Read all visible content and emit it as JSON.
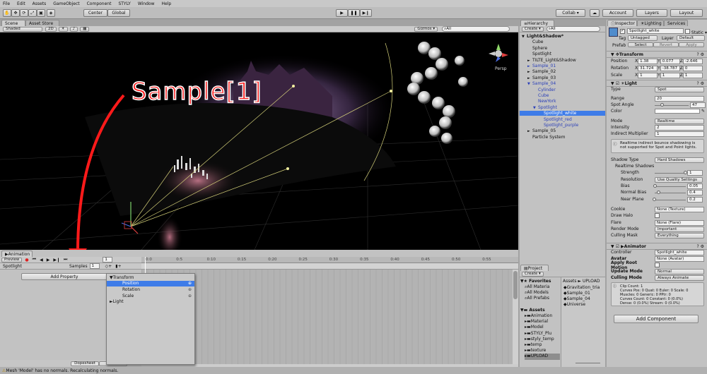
{
  "menu": [
    "File",
    "Edit",
    "Assets",
    "GameObject",
    "Component",
    "STYLY",
    "Window",
    "Help"
  ],
  "toolbar": {
    "center": "Center",
    "global": "Global",
    "collab": "Collab ▾",
    "account": "Account",
    "layers": "Layers",
    "layout": "Layout"
  },
  "scene": {
    "tab_scene": "Scene",
    "tab_asset_store": "Asset Store",
    "shaded": "Shaded",
    "mode2d": "2D",
    "gizmos": "Gizmos ▾",
    "search_all": "All",
    "persp": "Persp",
    "annotation": "Sample[1]"
  },
  "hierarchy": {
    "tab": "Hierarchy",
    "create": "Create ▾",
    "search_all": "All",
    "items": [
      {
        "label": "Light&Shadow*",
        "level": 0,
        "style": "bold",
        "arrow": "▼"
      },
      {
        "label": "Cube",
        "level": 1,
        "style": "",
        "arrow": ""
      },
      {
        "label": "Sphere",
        "level": 1,
        "style": "",
        "arrow": ""
      },
      {
        "label": "Spotlight",
        "level": 1,
        "style": "",
        "arrow": ""
      },
      {
        "label": "TILTE_Light&Shadow",
        "level": 1,
        "style": "",
        "arrow": "►"
      },
      {
        "label": "Sample_01",
        "level": 1,
        "style": "blue",
        "arrow": "►"
      },
      {
        "label": "Sample_02",
        "level": 1,
        "style": "",
        "arrow": "►"
      },
      {
        "label": "Sample_03",
        "level": 1,
        "style": "",
        "arrow": "►"
      },
      {
        "label": "Sample_04",
        "level": 1,
        "style": "blue",
        "arrow": "▼"
      },
      {
        "label": "Cylinder",
        "level": 2,
        "style": "blue",
        "arrow": ""
      },
      {
        "label": "Cube",
        "level": 2,
        "style": "blue",
        "arrow": ""
      },
      {
        "label": "NewYork",
        "level": 2,
        "style": "blue",
        "arrow": ""
      },
      {
        "label": "Spotlight",
        "level": 2,
        "style": "blue",
        "arrow": "▼"
      },
      {
        "label": "Spotlight_white",
        "level": 3,
        "style": "sel",
        "arrow": ""
      },
      {
        "label": "Spotlight_red",
        "level": 3,
        "style": "blue",
        "arrow": ""
      },
      {
        "label": "Spotlight_purple",
        "level": 3,
        "style": "blue",
        "arrow": ""
      },
      {
        "label": "Sample_05",
        "level": 1,
        "style": "",
        "arrow": "►"
      },
      {
        "label": "Particle System",
        "level": 1,
        "style": "",
        "arrow": ""
      }
    ]
  },
  "project": {
    "tab": "Project",
    "create": "Create ▾",
    "favorites": "Favorites",
    "fav_items": [
      "All Materia",
      "All Models",
      "All Prefabs"
    ],
    "assets": "Assets",
    "asset_items": [
      "Animation",
      "Material",
      "Model",
      "STYLY_Plu",
      "styly_temp",
      "temp",
      "texture",
      "UPLOAD"
    ],
    "breadcrumb": "Assets ► UPLOAD",
    "files": [
      "Gravitation_tria",
      "Sample_01",
      "Sample_04",
      "Universe"
    ]
  },
  "inspector": {
    "tab_inspector": "Inspector",
    "tab_lighting": "Lighting",
    "tab_services": "Services",
    "object_name": "Spotlight_white",
    "static": "Static ▾",
    "tag_label": "Tag",
    "tag_value": "Untagged",
    "layer_label": "Layer",
    "layer_value": "Default",
    "prefab_label": "Prefab",
    "prefab_select": "Select",
    "prefab_revert": "Revert",
    "prefab_apply": "Apply",
    "transform": {
      "title": "Transform",
      "position": "Position",
      "rotation": "Rotation",
      "scale": "Scale",
      "px": "1.38",
      "py": "0.077",
      "pz": "-2.646",
      "rx": "31.724",
      "ry": "-38.787",
      "rz": "0",
      "sx": "1",
      "sy": "1",
      "sz": "1"
    },
    "light": {
      "title": "Light",
      "type_label": "Type",
      "type_value": "Spot",
      "range_label": "Range",
      "range_value": "20",
      "spot_label": "Spot Angle",
      "spot_value": "47",
      "spot_fraction": 0.26,
      "color_label": "Color",
      "mode_label": "Mode",
      "mode_value": "Realtime",
      "intensity_label": "Intensity",
      "intensity_value": "2",
      "indirect_label": "Indirect Multiplier",
      "indirect_value": "1",
      "note": "Realtime indirect bounce shadowing is not supported for Spot and Point lights.",
      "shadow_type_label": "Shadow Type",
      "shadow_type_value": "Hard Shadows",
      "realtime_shadows": "Realtime Shadows",
      "strength_label": "Strength",
      "strength_value": "1",
      "strength_fraction": 1.0,
      "resolution_label": "Resolution",
      "resolution_value": "Use Quality Settings",
      "bias_label": "Bias",
      "bias_value": "0.05",
      "bias_fraction": 0.025,
      "normal_bias_label": "Normal Bias",
      "normal_bias_value": "0.4",
      "normal_bias_fraction": 0.13,
      "near_plane_label": "Near Plane",
      "near_plane_value": "0.2",
      "near_plane_fraction": 0.01,
      "cookie_label": "Cookie",
      "cookie_value": "None (Texture)",
      "draw_halo_label": "Draw Halo",
      "flare_label": "Flare",
      "flare_value": "None (Flare)",
      "render_mode_label": "Render Mode",
      "render_mode_value": "Important",
      "culling_label": "Culling Mask",
      "culling_value": "Everything"
    },
    "animator": {
      "title": "Animator",
      "controller_label": "Controller",
      "controller_value": "Spotlight_white",
      "avatar_label": "Avatar",
      "avatar_value": "None (Avatar)",
      "root_motion_label": "Apply Root Motion",
      "update_label": "Update Mode",
      "update_value": "Normal",
      "culling_label": "Culling Mode",
      "culling_value": "Always Animate",
      "stats": [
        "Clip Count: 1",
        "Curves Pos: 0 Quat: 0 Euler: 0 Scale: 0",
        "Muscles: 0 Generic: 0 PPtr: 0",
        "Curves Count: 0 Constant: 0 (0.0%)",
        "Dense: 0 (0.0%) Stream: 0 (0.0%)"
      ]
    },
    "add_component": "Add Component"
  },
  "animation": {
    "tab": "Animation",
    "preview": "Preview",
    "frame": "1",
    "samples_label": "Samples",
    "samples_value": "1",
    "clip": "Spotlight",
    "add_property": "Add Property",
    "dopesheet": "Dopesheet",
    "curves": "Curves",
    "ruler": [
      "0:0",
      "0:5",
      "0:10",
      "0:15",
      "0:20",
      "0:25",
      "0:30",
      "0:35",
      "0:40",
      "0:45",
      "0:50",
      "0:55"
    ],
    "popup": [
      {
        "label": "Transform",
        "arrow": "▼",
        "indent": 0,
        "sel": false
      },
      {
        "label": "Position",
        "arrow": "",
        "indent": 1,
        "sel": true
      },
      {
        "label": "Rotation",
        "arrow": "",
        "indent": 1,
        "sel": false
      },
      {
        "label": "Scale",
        "arrow": "",
        "indent": 1,
        "sel": false
      },
      {
        "label": "Light",
        "arrow": "►",
        "indent": 0,
        "sel": false
      }
    ]
  },
  "status": "Mesh 'Model' has no normals. Recalculating normals.",
  "colors": {
    "annotation_red": "#ff1a1a",
    "selection_blue": "#3e7ce8",
    "light_blue_text": "#2a3fb8"
  }
}
